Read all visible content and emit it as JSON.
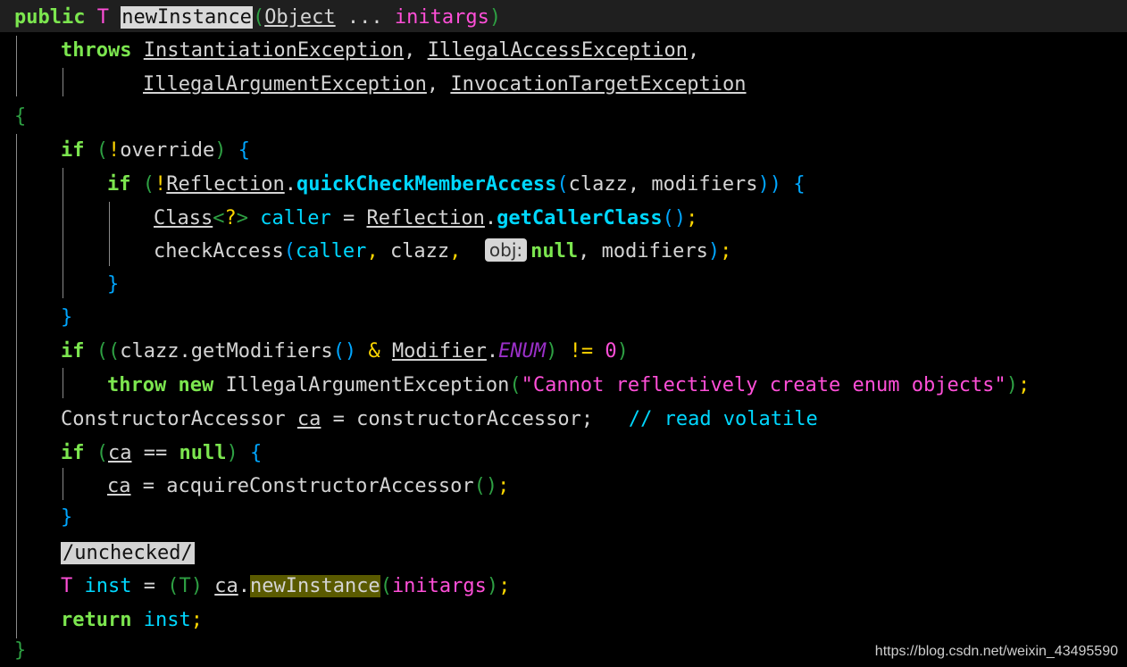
{
  "code": {
    "l1": {
      "kw": "public",
      "type": "T",
      "name": "newInstance",
      "open": "(",
      "param_type": "Object",
      "varargs": " ... ",
      "param": "initargs",
      "close": ")"
    },
    "l2": {
      "kw": "throws",
      "e1": "InstantiationException",
      "sep1": ",",
      "e2": "IllegalAccessException",
      "sep2": ","
    },
    "l3": {
      "e3": "IllegalArgumentException",
      "sep3": ",",
      "e4": "InvocationTargetException"
    },
    "l4": {
      "brace": "{"
    },
    "l5": {
      "kw": "if",
      "p1": "(",
      "bang": "!",
      "var": "override",
      "p2": ")",
      "brace": "{"
    },
    "l6": {
      "kw": "if",
      "p1": "(",
      "bang": "!",
      "cls": "Reflection",
      "dot": ".",
      "method": "quickCheckMemberAccess",
      "p2": "(",
      "a1": "clazz",
      "comma": ",",
      "a2": "modifiers",
      "p3": "))",
      "brace": "{"
    },
    "l7": {
      "type": "Class",
      "generic_open": "<",
      "wild": "?",
      "generic_close": ">",
      "var": "caller",
      "eq": "=",
      "cls": "Reflection",
      "dot": ".",
      "method": "getCallerClass",
      "call": "()",
      "semi": ";"
    },
    "l8": {
      "method": "checkAccess",
      "p1": "(",
      "a1": "caller",
      "c1": ",",
      "a2": "clazz",
      "c2": ",",
      "hint": "obj:",
      "a3": "null",
      "c3": ",",
      "a4": "modifiers",
      "p2": ")",
      "semi": ";"
    },
    "l9": {
      "brace": "}"
    },
    "l10": {
      "brace": "}"
    },
    "l11": {
      "kw": "if",
      "p1": "((",
      "var": "clazz",
      "dot": ".",
      "method": "getModifiers",
      "call": "()",
      "amp": "&",
      "cls": "Modifier",
      "dot2": ".",
      "const": "ENUM",
      "p2": ")",
      "neq": "!=",
      "zero": "0",
      "p3": ")"
    },
    "l12": {
      "kw1": "throw",
      "kw2": "new",
      "cls": "IllegalArgumentException",
      "p1": "(",
      "str": "\"Cannot reflectively create enum objects\"",
      "p2": ")",
      "semi": ";"
    },
    "l13": {
      "type": "ConstructorAccessor",
      "var": "ca",
      "eq": "=",
      "field": "constructorAccessor",
      "semi": ";",
      "comment": "// read volatile"
    },
    "l14": {
      "kw": "if",
      "p1": "(",
      "var": "ca",
      "eq": "==",
      "nul": "null",
      "p2": ")",
      "brace": "{"
    },
    "l15": {
      "var": "ca",
      "eq": "=",
      "method": "acquireConstructorAccessor",
      "call": "()",
      "semi": ";"
    },
    "l16": {
      "brace": "}"
    },
    "l17": {
      "annotation": "/unchecked/"
    },
    "l18": {
      "type": "T",
      "var": "inst",
      "eq": "=",
      "cast": "(T)",
      "obj": "ca",
      "dot": ".",
      "method": "newInstance",
      "p1": "(",
      "arg": "initargs",
      "p2": ")",
      "semi": ";"
    },
    "l19": {
      "kw": "return",
      "var": "inst",
      "semi": ";"
    },
    "l20": {
      "brace": "}"
    }
  },
  "watermark": "https://blog.csdn.net/weixin_43495590",
  "colors": {
    "background": "#000000",
    "keyword": "#7ce64f",
    "type_param": "#ff4fd8",
    "method": "#00d7ff",
    "string": "#ff4fd8",
    "comment": "#00d7ff",
    "enum_const": "#9b30c8"
  }
}
